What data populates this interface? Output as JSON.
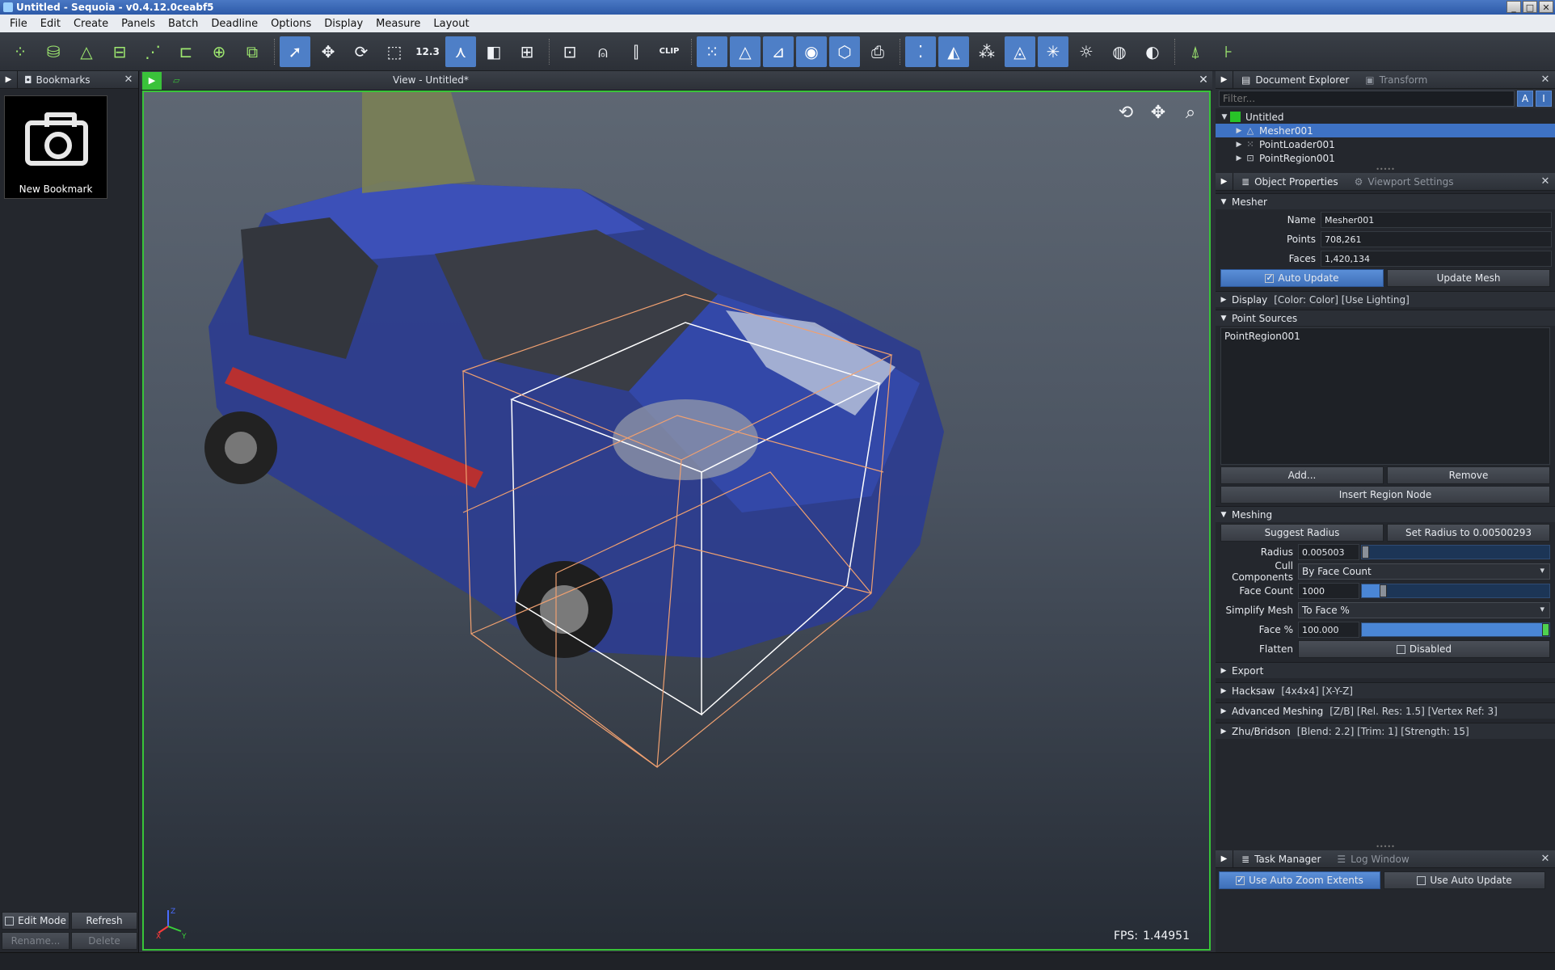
{
  "window": {
    "title": "Untitled - Sequoia - v0.4.12.0ceabf5",
    "controls": [
      "_",
      "□",
      "✕"
    ]
  },
  "menubar": [
    "File",
    "Edit",
    "Create",
    "Panels",
    "Batch",
    "Deadline",
    "Options",
    "Display",
    "Measure",
    "Layout"
  ],
  "toolbar": {
    "numeric_tool_label": "12.3",
    "clip_label": "CLIP"
  },
  "bookmarks_panel": {
    "title": "Bookmarks",
    "new_bookmark_label": "New Bookmark",
    "edit_mode_label": "Edit Mode",
    "refresh_label": "Refresh",
    "rename_label": "Rename...",
    "delete_label": "Delete"
  },
  "view": {
    "title": "View - Untitled*",
    "fps_label": "FPS:",
    "fps_value": "1.44951",
    "axis_labels": {
      "x": "X",
      "y": "Y",
      "z": "Z"
    }
  },
  "document_explorer": {
    "tab_label": "Document Explorer",
    "transform_tab_label": "Transform",
    "filter_placeholder": "Filter...",
    "filter_btn_a": "A",
    "filter_btn_b": "I",
    "tree": {
      "root": "Untitled",
      "children": [
        "Mesher001",
        "PointLoader001",
        "PointRegion001"
      ],
      "selected": "Mesher001"
    }
  },
  "object_properties": {
    "tab_label": "Object Properties",
    "viewport_settings_tab_label": "Viewport Settings",
    "mesher": {
      "section_label": "Mesher",
      "name_label": "Name",
      "name_value": "Mesher001",
      "points_label": "Points",
      "points_value": "708,261",
      "faces_label": "Faces",
      "faces_value": "1,420,134",
      "auto_update_label": "Auto Update",
      "update_mesh_label": "Update Mesh"
    },
    "display_section": {
      "label": "Display",
      "details": "[Color: Color] [Use Lighting]"
    },
    "point_sources": {
      "section_label": "Point Sources",
      "items": [
        "PointRegion001"
      ],
      "add_label": "Add...",
      "remove_label": "Remove",
      "insert_label": "Insert Region Node"
    },
    "meshing": {
      "section_label": "Meshing",
      "suggest_radius_label": "Suggest Radius",
      "set_radius_label": "Set Radius to 0.00500293",
      "radius_label": "Radius",
      "radius_value": "0.005003",
      "radius_fraction": 0.0,
      "cull_label": "Cull Components",
      "cull_value": "By Face Count",
      "face_count_label": "Face Count",
      "face_count_value": "1000",
      "face_count_fraction": 0.1,
      "simplify_label": "Simplify Mesh",
      "simplify_value": "To Face %",
      "face_pct_label": "Face %",
      "face_pct_value": "100.000",
      "face_pct_fraction": 1.0,
      "flatten_label": "Flatten",
      "flatten_value": "Disabled"
    },
    "collapsed_sections": [
      {
        "label": "Export",
        "details": ""
      },
      {
        "label": "Hacksaw",
        "details": "[4x4x4] [X-Y-Z]"
      },
      {
        "label": "Advanced Meshing",
        "details": "[Z/B] [Rel. Res: 1.5] [Vertex Ref: 3]"
      },
      {
        "label": "Zhu/Bridson",
        "details": "[Blend: 2.2] [Trim: 1] [Strength: 15]"
      }
    ]
  },
  "task_manager": {
    "tab_label": "Task Manager",
    "log_tab_label": "Log Window",
    "auto_zoom_label": "Use Auto Zoom Extents",
    "auto_update_label": "Use Auto Update"
  },
  "colors": {
    "accent_blue": "#3e72c4",
    "viewport_border": "#38c438",
    "toolbar_green": "#9ee86f",
    "bbox_orange": "#f0a070"
  }
}
